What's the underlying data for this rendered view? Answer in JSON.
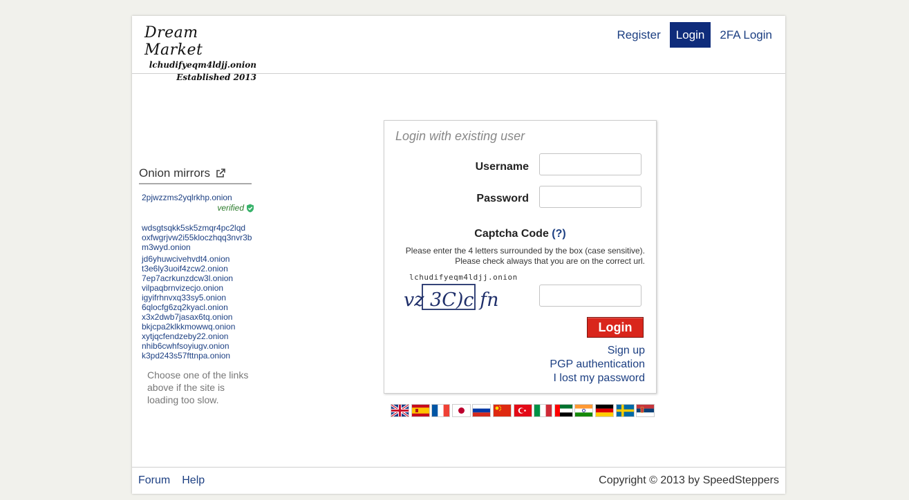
{
  "brand": {
    "name": "Dream Market",
    "onion": "lchudifyeqm4ldjj.onion",
    "established": "Established 2013"
  },
  "nav": {
    "register": "Register",
    "login": "Login",
    "twofa": "2FA Login"
  },
  "sidebar": {
    "title": "Onion mirrors",
    "verified_mirror": "2pjwzzms2yqlrkhp.onion",
    "verified_label": "verified",
    "mirrors": [
      "wdsgtsqkk5sk5zmqr4pc2lqd",
      "oxfwgrjvw2i55kloczhqq3nvr3b",
      "m3wyd.onion",
      "jd6yhuwcivehvdt4.onion",
      "t3e6ly3uoif4zcw2.onion",
      "7ep7acrkunzdcw3l.onion",
      "vilpaqbrnvizecjo.onion",
      "igyifrhnvxq33sy5.onion",
      "6qlocfg6zq2kyacl.onion",
      "x3x2dwb7jasax6tq.onion",
      "bkjcpa2klkkmowwq.onion",
      "xytjqcfendzeby22.onion",
      "nhib6cwhfsoyiugv.onion",
      "k3pd243s57fttnpa.onion"
    ],
    "note": "Choose one of the links above if the site is loading too slow."
  },
  "login": {
    "title": "Login with existing user",
    "username_label": "Username",
    "password_label": "Password",
    "captcha_title": "Captcha Code",
    "captcha_help_link": "(?)",
    "captcha_help_line1": "Please enter the 4 letters surrounded by the box (case sensitive).",
    "captcha_help_line2": "Please check always that you are on the correct url.",
    "captcha_onion": "lchudifyeqm4ldjj.onion",
    "captcha_text": "vz 3C)c fn",
    "button": "Login",
    "signup": "Sign up",
    "pgp": "PGP authentication",
    "lost": "I lost my password"
  },
  "flags": [
    "uk-flag-icon",
    "spain-flag-icon",
    "france-flag-icon",
    "japan-flag-icon",
    "russia-flag-icon",
    "china-flag-icon",
    "turkey-flag-icon",
    "italy-flag-icon",
    "uae-flag-icon",
    "india-flag-icon",
    "germany-flag-icon",
    "sweden-flag-icon",
    "serbia-flag-icon"
  ],
  "footer": {
    "forum": "Forum",
    "help": "Help",
    "copyright": "Copyright © 2013 by SpeedSteppers"
  },
  "colors": {
    "link": "#1c3f82",
    "nav_active": "#0f2c7b",
    "login_button": "#d9261c",
    "verified": "#2a7a2a"
  }
}
